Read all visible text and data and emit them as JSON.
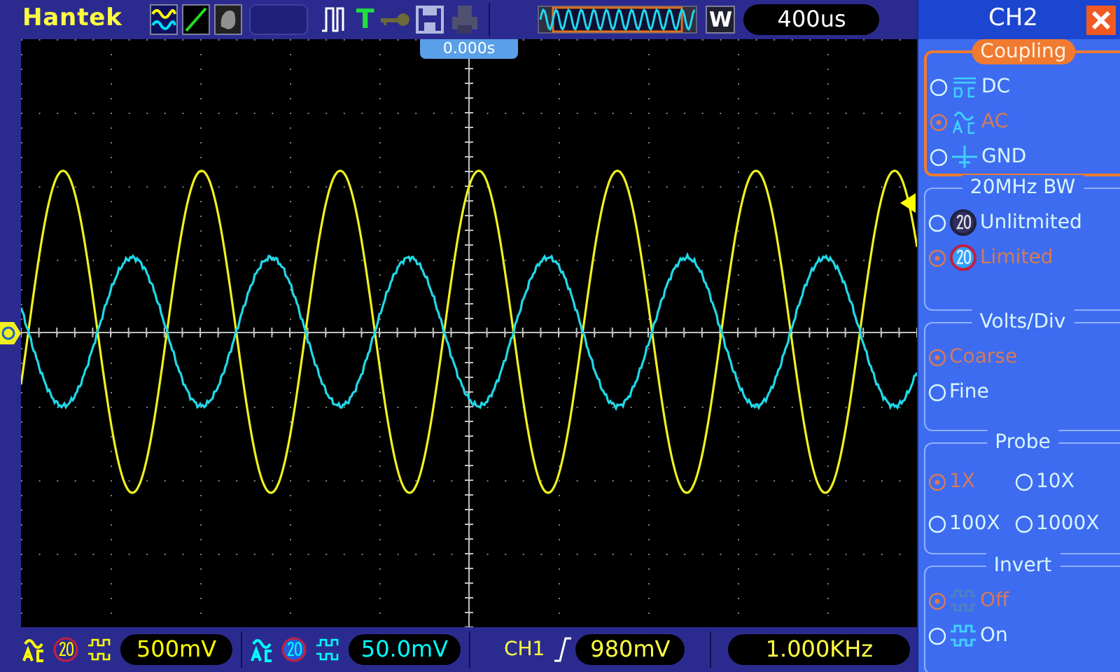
{
  "top_bar": {
    "brand": "Hantek",
    "trigger_mode_label": "T",
    "window_button": "W",
    "timebase": "400us"
  },
  "display": {
    "time_marker": "0.000s"
  },
  "panel": {
    "title": "CH2",
    "groups": [
      {
        "title": "Coupling",
        "active": true,
        "kind": "list",
        "options": [
          {
            "label": "DC",
            "kind": "dc",
            "selected": false
          },
          {
            "label": "AC",
            "kind": "ac",
            "selected": true
          },
          {
            "label": "GND",
            "kind": "gnd",
            "selected": false
          }
        ]
      },
      {
        "title": "20MHz BW",
        "active": false,
        "kind": "list",
        "options": [
          {
            "label": "Unlitmited",
            "kind": "bw-full",
            "selected": false
          },
          {
            "label": "Limited",
            "kind": "bw-limit",
            "selected": true
          }
        ]
      },
      {
        "title": "Volts/Div",
        "active": false,
        "kind": "list",
        "options": [
          {
            "label": "Coarse",
            "kind": "plain",
            "selected": true
          },
          {
            "label": "Fine",
            "kind": "plain",
            "selected": false
          }
        ]
      },
      {
        "title": "Probe",
        "active": false,
        "kind": "grid",
        "options": [
          {
            "label": "1X",
            "kind": "plain",
            "selected": true
          },
          {
            "label": "10X",
            "kind": "plain",
            "selected": false
          },
          {
            "label": "100X",
            "kind": "plain",
            "selected": false
          },
          {
            "label": "1000X",
            "kind": "plain",
            "selected": false
          }
        ]
      },
      {
        "title": "Invert",
        "active": false,
        "kind": "list",
        "options": [
          {
            "label": "Off",
            "kind": "invert",
            "selected": true
          },
          {
            "label": "On",
            "kind": "invert",
            "selected": false
          }
        ]
      }
    ]
  },
  "status_bar": {
    "channels": [
      {
        "scale": "500mV",
        "color": "#ffff00"
      },
      {
        "scale": "50.0mV",
        "color": "#00ffff"
      }
    ],
    "trigger": {
      "source": "CH1",
      "level": "980mV"
    },
    "frequency": "1.000KHz"
  }
}
